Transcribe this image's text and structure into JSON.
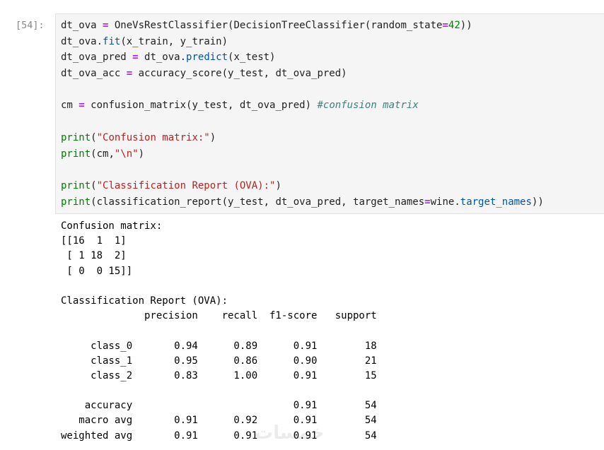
{
  "cell": {
    "prompt": "[54]:",
    "code_lines": [
      [
        {
          "t": "dt_ova "
        },
        {
          "t": "=",
          "c": "op"
        },
        {
          "t": " OneVsRestClassifier(DecisionTreeClassifier(random_state"
        },
        {
          "t": "=",
          "c": "op"
        },
        {
          "t": "42",
          "c": "num"
        },
        {
          "t": "))"
        }
      ],
      [
        {
          "t": "dt_ova."
        },
        {
          "t": "fit",
          "c": "fn"
        },
        {
          "t": "(x_train, y_train)"
        }
      ],
      [
        {
          "t": "dt_ova_pred "
        },
        {
          "t": "=",
          "c": "op"
        },
        {
          "t": " dt_ova."
        },
        {
          "t": "predict",
          "c": "fn"
        },
        {
          "t": "(x_test)"
        }
      ],
      [
        {
          "t": "dt_ova_acc "
        },
        {
          "t": "=",
          "c": "op"
        },
        {
          "t": " accuracy_score(y_test, dt_ova_pred)"
        }
      ],
      [],
      [
        {
          "t": "cm "
        },
        {
          "t": "=",
          "c": "op"
        },
        {
          "t": " confusion_matrix(y_test, dt_ova_pred) "
        },
        {
          "t": "#confusion matrix",
          "c": "cm"
        }
      ],
      [],
      [
        {
          "t": "print",
          "c": "kw"
        },
        {
          "t": "("
        },
        {
          "t": "\"Confusion matrix:\"",
          "c": "str"
        },
        {
          "t": ")"
        }
      ],
      [
        {
          "t": "print",
          "c": "kw"
        },
        {
          "t": "(cm,"
        },
        {
          "t": "\"\\n\"",
          "c": "str"
        },
        {
          "t": ")"
        }
      ],
      [],
      [
        {
          "t": "print",
          "c": "kw"
        },
        {
          "t": "("
        },
        {
          "t": "\"Classification Report (OVA):\"",
          "c": "str"
        },
        {
          "t": ")"
        }
      ],
      [
        {
          "t": "print",
          "c": "kw"
        },
        {
          "t": "(classification_report(y_test, dt_ova_pred, target_names"
        },
        {
          "t": "=",
          "c": "op"
        },
        {
          "t": "wine."
        },
        {
          "t": "target_names",
          "c": "attr"
        },
        {
          "t": "))"
        }
      ]
    ]
  },
  "output_lines": [
    "Confusion matrix:",
    "[[16  1  1]",
    " [ 1 18  2]",
    " [ 0  0 15]]",
    "",
    "Classification Report (OVA):",
    "              precision    recall  f1-score   support",
    "",
    "     class_0       0.94      0.89      0.91        18",
    "     class_1       0.95      0.86      0.90        21",
    "     class_2       0.83      1.00      0.91        15",
    "",
    "    accuracy                           0.91        54",
    "   macro avg       0.91      0.92      0.91        54",
    "weighted avg       0.91      0.91      0.91        54"
  ],
  "watermark": "خمسات"
}
